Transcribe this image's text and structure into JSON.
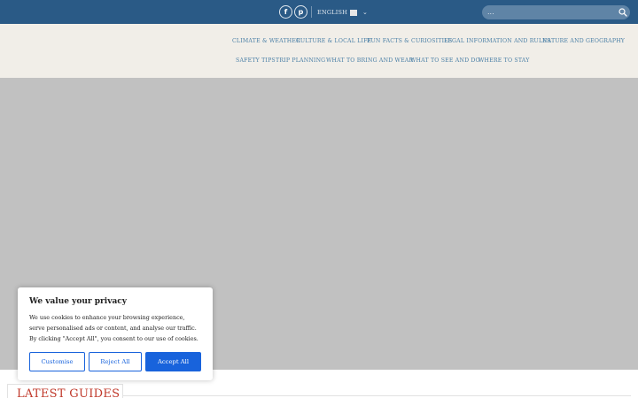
{
  "topbar": {
    "social": [
      {
        "name": "facebook",
        "glyph": "f"
      },
      {
        "name": "pinterest",
        "glyph": "p"
      }
    ],
    "language": {
      "label": "ENGLISH"
    },
    "search": {
      "text": "..."
    }
  },
  "nav": {
    "row1": [
      "CLIMATE & WEATHER",
      "CULTURE & LOCAL LIFE",
      "FUN FACTS & CURIOSITIES",
      "LEGAL INFORMATION AND RULES",
      "NATURE AND GEOGRAPHY"
    ],
    "row2": [
      "SAFETY TIPS",
      "TRIP PLANNING",
      "WHAT TO BRING AND WEAR",
      "WHAT TO SEE AND DO",
      "WHERE TO STAY"
    ]
  },
  "section": {
    "latest_guides": "LATEST GUIDES"
  },
  "cookie": {
    "title": "We value your privacy",
    "body": [
      "We use cookies to enhance your browsing experience,",
      "serve personalised ads or content, and analyse our traffic.",
      "By clicking \"Accept All\", you consent to our use of cookies."
    ],
    "customise": "Customise",
    "reject": "Reject All",
    "accept": "Accept All"
  },
  "colors": {
    "topbar": "#2a5a86",
    "nav_background": "#f1eee8",
    "nav_text": "#4a7fa6",
    "accent_red": "#c0392b",
    "cookie_blue": "#1863dc"
  }
}
